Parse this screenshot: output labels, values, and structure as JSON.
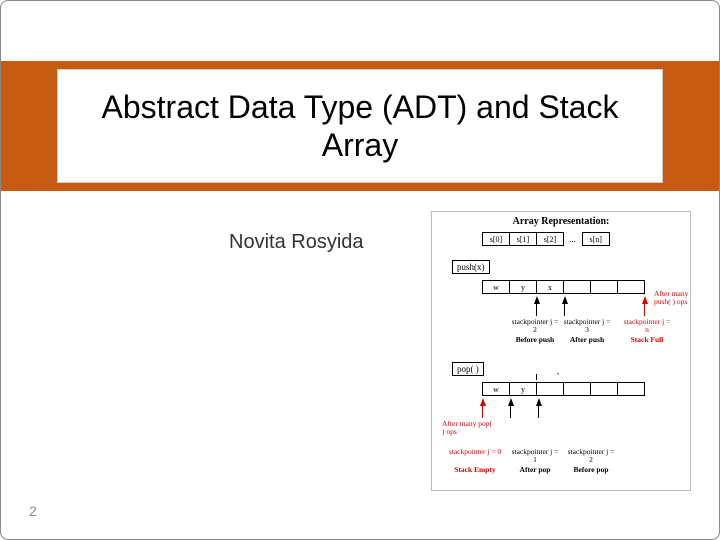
{
  "slide": {
    "title": "Abstract Data Type (ADT) and Stack Array",
    "author": "Novita Rosyida",
    "page_number": "2"
  },
  "diagram": {
    "title": "Array Representation:",
    "index_cells": [
      "s[0]",
      "s[1]",
      "s[2]",
      "s[n]"
    ],
    "push_label": "push(x)",
    "pop_label": "pop( )",
    "push_row": [
      "w",
      "y",
      "x",
      "",
      "",
      ""
    ],
    "pop_row": [
      "w",
      "y",
      "",
      "",
      "",
      ""
    ],
    "push": {
      "before_sp": "stackpointer j = 2",
      "before_label": "Before push",
      "after_sp": "stackpointer j = 3",
      "after_label": "After push",
      "full_note": "After many push( ) ops",
      "full_sp": "stackpointer j = n",
      "full_label": "Stack Full"
    },
    "pop": {
      "empty_note": "After many pop( ) ops",
      "empty_sp": "stackpointer j = 0",
      "empty_label": "Stack Empty",
      "after_sp": "stackpointer j = 1",
      "after_label": "After pop",
      "before_sp": "stackpointer j = 2",
      "before_label": "Before pop"
    }
  }
}
